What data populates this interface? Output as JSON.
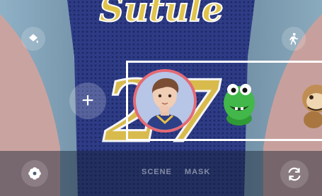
{
  "background": {
    "jersey_letters": "Sutule",
    "jersey_number": "27"
  },
  "toolbar": {
    "add_label": "+"
  },
  "modes": [
    "SCENE",
    "MASK"
  ],
  "colors": {
    "selection_ring": "#e36a75",
    "selection_box": "#ffffff",
    "avatar_bg": "#b7c5e6"
  },
  "icons": {
    "beautify": "paint-bucket-icon",
    "body": "body-pose-icon",
    "filter": "flower-icon",
    "switch_camera": "switch-camera-icon"
  }
}
